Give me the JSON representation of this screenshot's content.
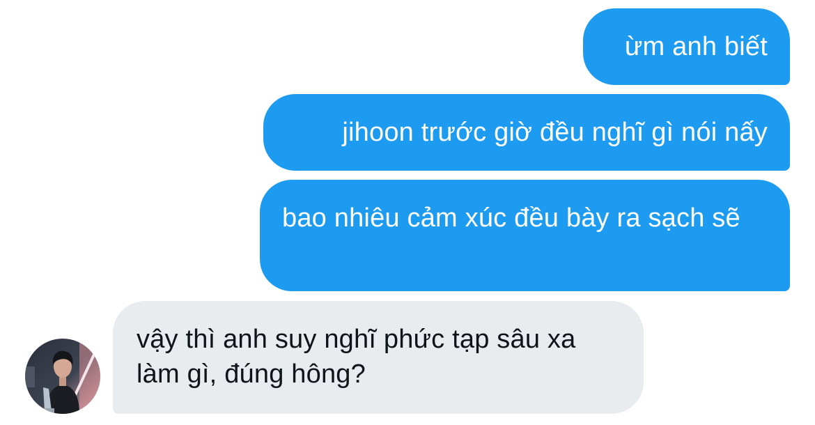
{
  "conversation": {
    "messages": [
      {
        "direction": "sent",
        "text": "ừm anh biết"
      },
      {
        "direction": "sent",
        "text": "jihoon trước giờ đều nghĩ gì nói nấy"
      },
      {
        "direction": "sent",
        "text": "bao nhiêu cảm xúc đều bày ra sạch sẽ"
      },
      {
        "direction": "received",
        "text": "vậy thì anh suy nghĩ phức tạp sâu xa làm gì, đúng hông?"
      }
    ]
  },
  "colors": {
    "sent_bubble": "#1d9bf0",
    "received_bubble": "#e8ecef",
    "received_text": "#0f1419"
  }
}
